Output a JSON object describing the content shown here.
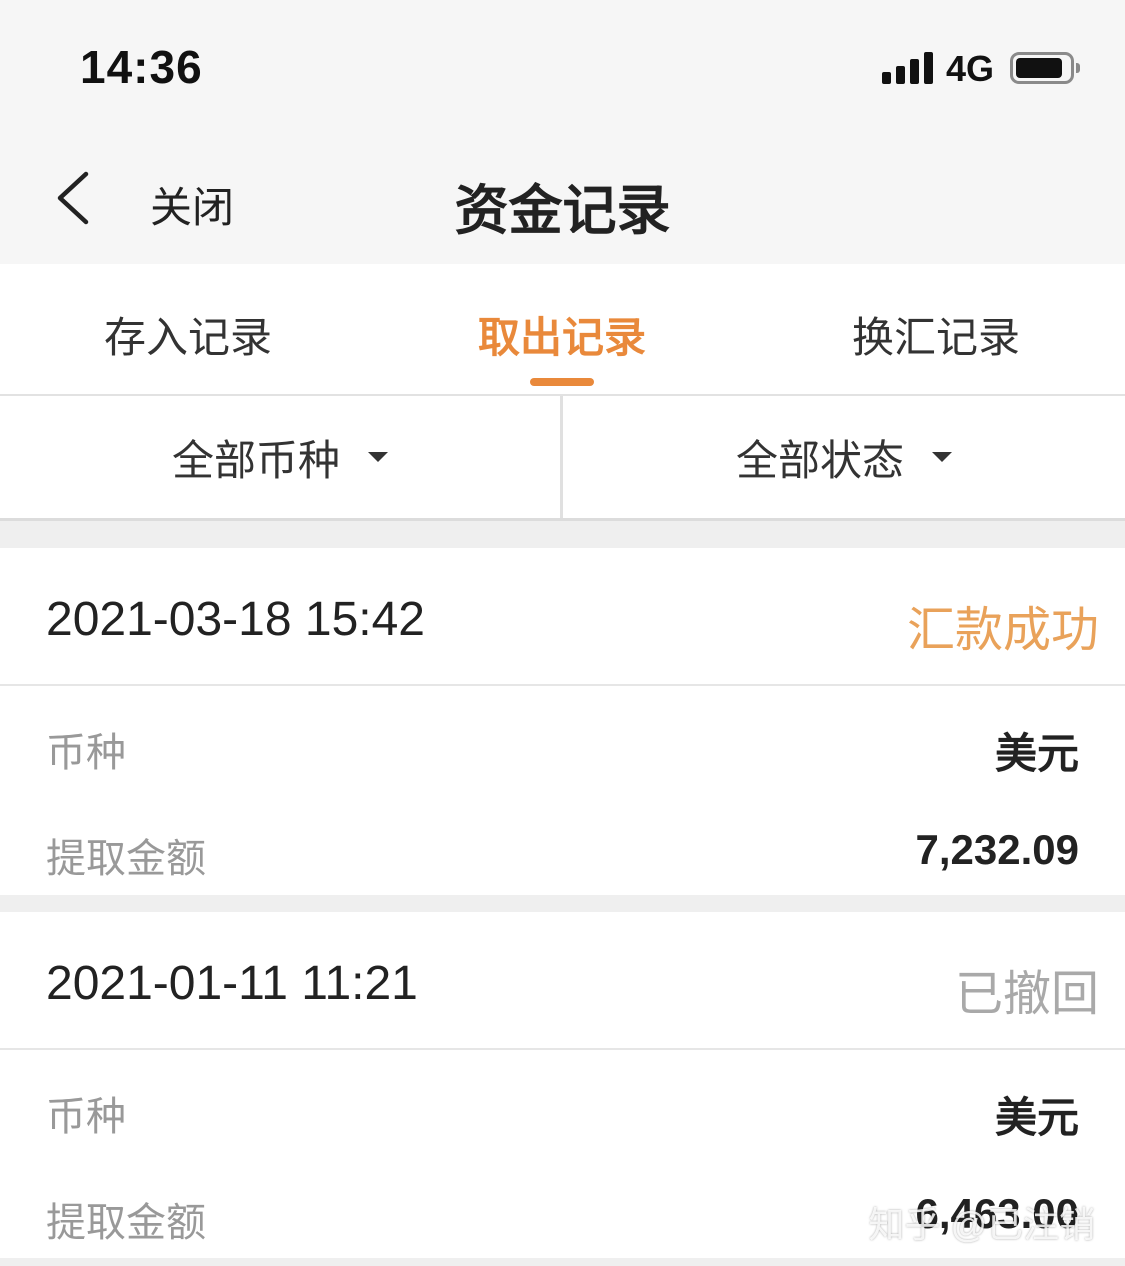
{
  "status_bar": {
    "time": "14:36",
    "network": "4G"
  },
  "nav": {
    "close_label": "关闭",
    "title": "资金记录"
  },
  "tabs": [
    {
      "label": "存入记录",
      "active": false
    },
    {
      "label": "取出记录",
      "active": true
    },
    {
      "label": "换汇记录",
      "active": false
    }
  ],
  "filters": {
    "currency": "全部币种",
    "status": "全部状态"
  },
  "records": [
    {
      "date": "2021-03-18 15:42",
      "status": "汇款成功",
      "currency_label": "币种",
      "currency": "美元",
      "amount_label": "提取金额",
      "amount": "7,232.09"
    },
    {
      "date": "2021-01-11 11:21",
      "status": "已撤回",
      "currency_label": "币种",
      "currency": "美元",
      "amount_label": "提取金额",
      "amount": "6,463.00"
    }
  ],
  "watermark": "知乎 @已注销",
  "colors": {
    "accent": "#e9893b",
    "success": "#e9a25a",
    "muted": "#a9a9a9"
  }
}
